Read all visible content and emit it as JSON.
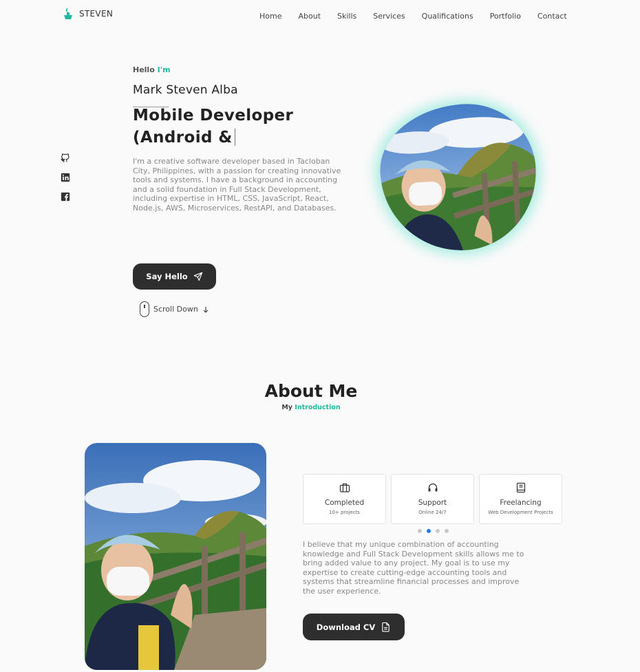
{
  "nav": {
    "logo_text": "STEVEN",
    "items": [
      "Home",
      "About",
      "Skills",
      "Services",
      "Qualifications",
      "Portfolio",
      "Contact"
    ]
  },
  "social": [
    "github-icon",
    "linkedin-icon",
    "facebook-icon"
  ],
  "hero": {
    "hello": "Hello",
    "hello_accent": "I'm",
    "name": "Mark Steven Alba",
    "role": "Mobile Developer (Android &",
    "description": "I'm a creative software developer based in Tacloban City, Philippines, with a passion for creating innovative tools and systems. I have a background in accounting and a solid foundation in Full Stack Development, including expertise in HTML, CSS, JavaScript, React, Node.js, AWS, Microservices, RestAPI, and Databases.",
    "cta_label": "Say Hello",
    "scroll_label": "Scroll Down"
  },
  "about": {
    "title": "About Me",
    "subtitle": "My",
    "subtitle_accent": "Introduction",
    "cards": [
      {
        "icon": "briefcase-icon",
        "title": "Completed",
        "sub": "10+ projects"
      },
      {
        "icon": "headset-icon",
        "title": "Support",
        "sub": "Online 24/7"
      },
      {
        "icon": "book-icon",
        "title": "Freelancing",
        "sub": "Web Development Projects"
      }
    ],
    "carousel_active_index": 1,
    "text": "I believe that my unique combination of accounting knowledge and Full Stack Development skills allows me to bring added value to any project. My goal is to use my expertise to create cutting-edge accounting tools and systems that streamline financial processes and improve the user experience.",
    "cv_label": "Download CV"
  },
  "colors": {
    "accent": "#1fb8a0",
    "button_dark": "#2e2e2e",
    "dot_active": "#1e7be8"
  }
}
